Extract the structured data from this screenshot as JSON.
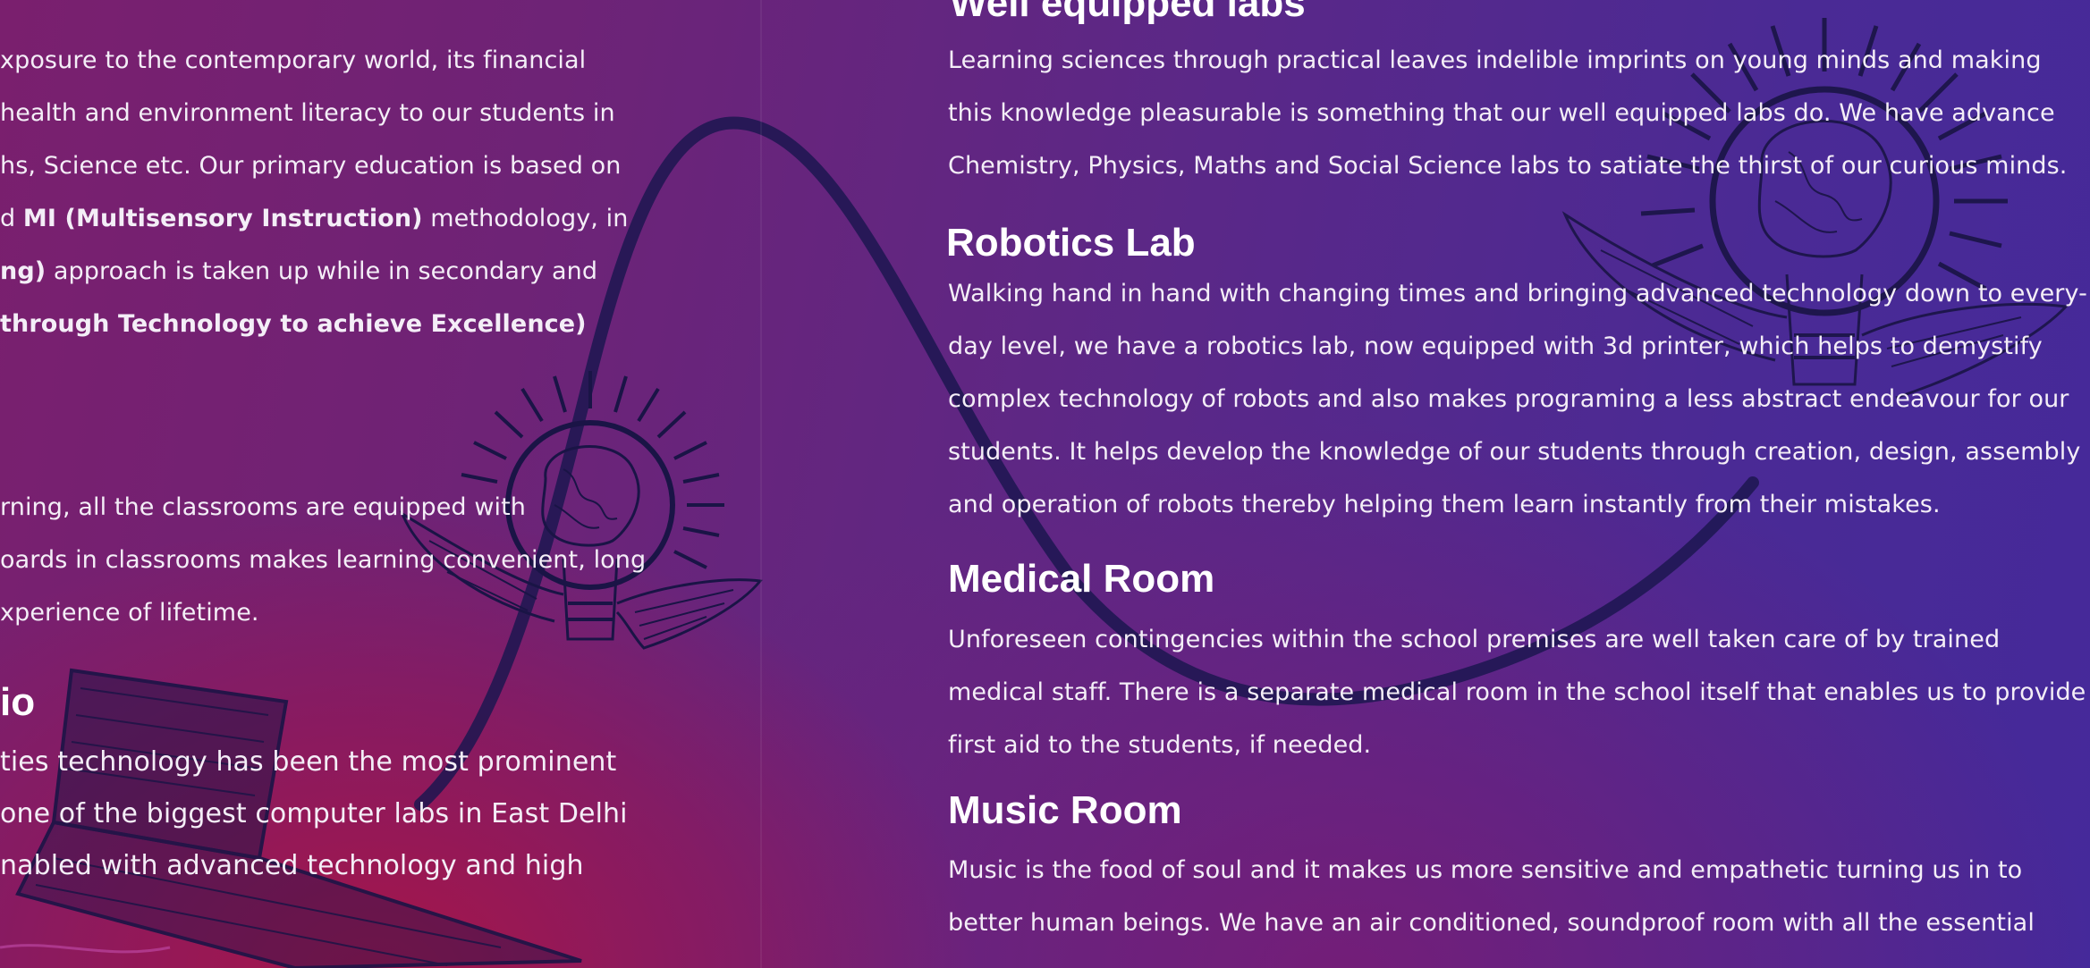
{
  "left_column": {
    "para1_lines": [
      "xposure to the contemporary world, its financial",
      "health and environment literacy to our students in",
      "hs, Science etc. Our primary education is based on",
      {
        "a": "d ",
        "b": "MI (Multisensory Instruction)",
        "c": " methodology, in"
      },
      {
        "b": "ng)",
        "c": " approach is taken up while in secondary and"
      },
      {
        "b": "through Technology to achieve Excellence)"
      }
    ],
    "para2_lines": [
      "rning, all the classrooms are equipped with",
      "oards in classrooms makes learning convenient, long",
      "xperience of lifetime."
    ],
    "heading3": "io",
    "para3_lines": [
      "ties technology has been the most prominent",
      "one of the biggest computer labs in East Delhi",
      "nabled with advanced technology and high"
    ]
  },
  "right_column": {
    "labs": {
      "heading": "Well equipped labs",
      "lines": [
        "Learning sciences through practical leaves indelible imprints on young minds and making",
        "this knowledge pleasurable is something that our well equipped labs do. We have advance",
        "Chemistry, Physics, Maths and Social Science labs to satiate the thirst of our curious minds."
      ]
    },
    "robotics": {
      "heading": "Robotics Lab",
      "lines": [
        "Walking hand in hand with changing times and bringing advanced technology down to every-",
        "day level, we have a robotics lab, now equipped with 3d printer, which helps to demystify",
        "complex technology of robots and also makes programing a less abstract endeavour for our",
        "students. It helps develop the knowledge of our students through creation, design,  assembly",
        "and operation of robots thereby helping them learn instantly from their mistakes."
      ]
    },
    "medical": {
      "heading": "Medical Room",
      "lines": [
        "Unforeseen contingencies within the school premises are well taken care of by trained",
        "medical staff. There is a separate medical room in the school itself that enables us to provide",
        "first aid to the students, if needed."
      ]
    },
    "music": {
      "heading": "Music Room",
      "lines": [
        "Music is the food of soul and it makes us more sensitive and empathetic turning us in to",
        "better human beings. We have an air conditioned, soundproof room with all the essential"
      ]
    }
  },
  "icons": [
    "winged-lightbulb-brain-icon",
    "winged-lightbulb-brain-icon",
    "laptop-sketch-icon"
  ],
  "colors": {
    "bg_left": "#7a1f6e",
    "bg_right": "#45299a",
    "bg_bottom": "#a0145a",
    "ink": "#1a1446",
    "text": "#ffffff"
  }
}
